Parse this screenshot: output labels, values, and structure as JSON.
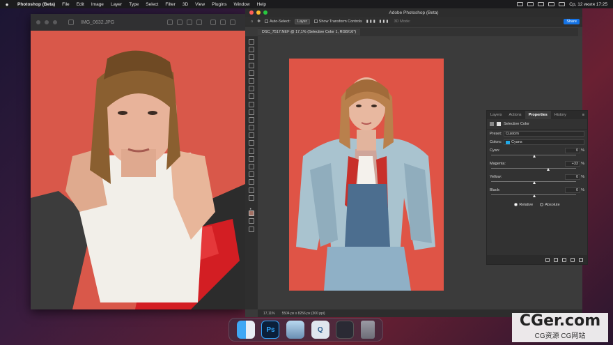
{
  "menubar": {
    "app": "Photoshop (Beta)",
    "items": [
      "File",
      "Edit",
      "Image",
      "Layer",
      "Type",
      "Select",
      "Filter",
      "3D",
      "View",
      "Plugins",
      "Window",
      "Help"
    ],
    "clock": "Ср, 12 июля  17:25"
  },
  "preview": {
    "filename": "IMG_0632.JPG"
  },
  "photoshop": {
    "window_title": "Adobe Photoshop (Beta)",
    "options": {
      "auto_select_label": "Auto-Select:",
      "auto_select_value": "Layer",
      "transform_label": "Show Transform Controls",
      "mode_3d": "3D Mode:",
      "share_label": "Share"
    },
    "doc_tab": "DSC_7517.NEF @ 17,1% (Selective Color 1, RGB/16*)",
    "status": {
      "zoom": "17,11%",
      "dims": "5504 px x 8256 px (300 ppi)"
    }
  },
  "properties": {
    "tabs": [
      "Layers",
      "Actions",
      "Properties",
      "History"
    ],
    "active_tab": "Properties",
    "adjustment": "Selective Color",
    "preset_label": "Preset:",
    "preset_value": "Custom",
    "colors_label": "Colors:",
    "colors_value": "Cyans",
    "sliders": [
      {
        "label": "Cyan:",
        "value": "0",
        "pos": 0.5
      },
      {
        "label": "Magenta:",
        "value": "+33",
        "pos": 0.665
      },
      {
        "label": "Yellow:",
        "value": "0",
        "pos": 0.5
      },
      {
        "label": "Black:",
        "value": "0",
        "pos": 0.5
      }
    ],
    "radio_relative": "Relative",
    "radio_absolute": "Absolute",
    "selected_method": "Relative"
  },
  "dock": {
    "apps": [
      "finder-icon",
      "photoshop-icon",
      "preview-icon",
      "quicktime-icon",
      "launchpad-icon",
      "trash-icon"
    ],
    "ps_label": "Ps"
  },
  "watermark": {
    "main": "CGer.com",
    "sub": "CG资源  CG网站"
  },
  "colors": {
    "accent": "#1473e6",
    "photo_bg": "#de5244",
    "cyan_swatch": "#21a8e6"
  }
}
